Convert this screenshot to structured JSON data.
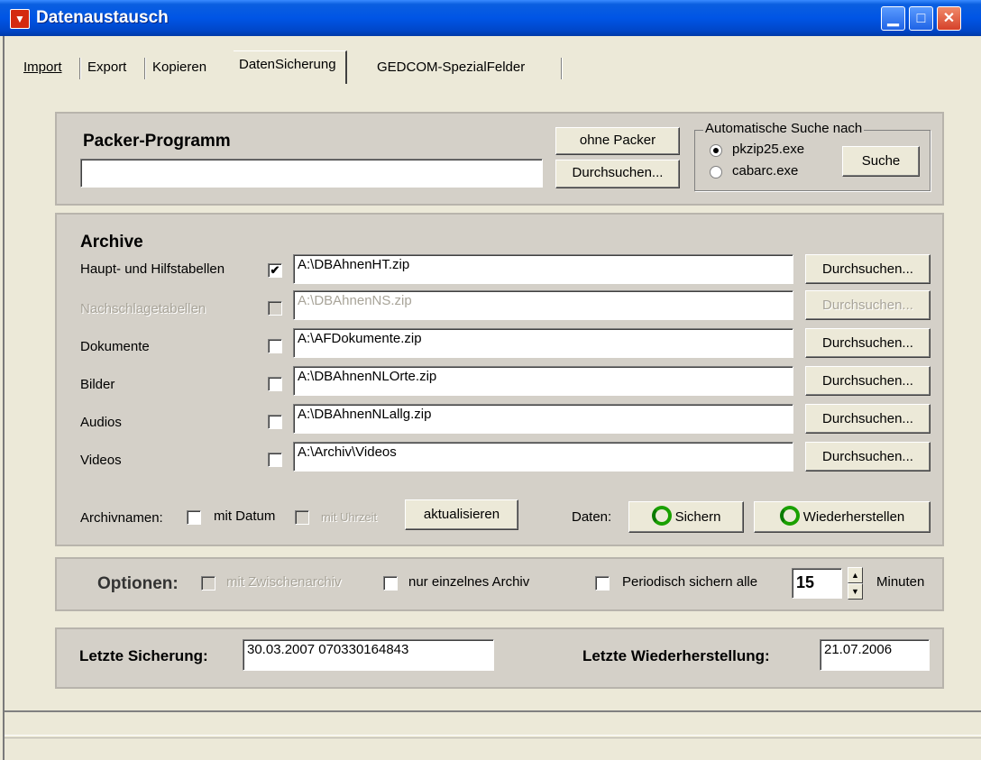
{
  "window": {
    "title": "Datenaustausch",
    "app_icon": "bavaria-flag-icon"
  },
  "tabs": [
    {
      "label": "Import"
    },
    {
      "label": "Export"
    },
    {
      "label": "Kopieren"
    },
    {
      "label": "DatenSicherung",
      "active": true
    },
    {
      "label": "GEDCOM-SpezialFelder"
    }
  ],
  "packer": {
    "heading": "Packer-Programm",
    "path_value": "",
    "ohne_packer_label": "ohne Packer",
    "browse_label": "Durchsuchen...",
    "auto_search": {
      "legend": "Automatische Suche nach",
      "options": [
        {
          "label": "pkzip25.exe",
          "selected": true
        },
        {
          "label": "cabarc.exe",
          "selected": false
        }
      ],
      "search_label": "Suche"
    }
  },
  "archive": {
    "heading": "Archive",
    "rows": [
      {
        "label": "Haupt- und Hilfstabellen",
        "checked": true,
        "enabled": true,
        "path": "A:\\DBAhnenHT.zip",
        "browse": "Durchsuchen..."
      },
      {
        "label": "Nachschlagetabellen",
        "checked": false,
        "enabled": false,
        "path": "A:\\DBAhnenNS.zip",
        "browse": "Durchsuchen..."
      },
      {
        "label": "Dokumente",
        "checked": false,
        "enabled": true,
        "path": "A:\\AFDokumente.zip",
        "browse": "Durchsuchen..."
      },
      {
        "label": "Bilder",
        "checked": false,
        "enabled": true,
        "path": "A:\\DBAhnenNLOrte.zip",
        "browse": "Durchsuchen..."
      },
      {
        "label": "Audios",
        "checked": false,
        "enabled": true,
        "path": "A:\\DBAhnenNLallg.zip",
        "browse": "Durchsuchen..."
      },
      {
        "label": "Videos",
        "checked": false,
        "enabled": true,
        "path": "A:\\Archiv\\Videos",
        "browse": "Durchsuchen..."
      }
    ],
    "names_label": "Archivnamen:",
    "mit_datum": "mit Datum",
    "mit_uhrzeit": "mit Uhrzeit",
    "aktualisieren": "aktualisieren",
    "daten_label": "Daten:",
    "sichern": "Sichern",
    "wiederherstellen": "Wiederherstellen"
  },
  "options": {
    "heading": "Optionen:",
    "zwischenarchiv": "mit Zwischenarchiv",
    "einzelnes": "nur einzelnes Archiv",
    "periodisch": "Periodisch sichern alle",
    "minutes_value": "15",
    "minuten": "Minuten"
  },
  "history": {
    "letzte_sicherung_label": "Letzte Sicherung:",
    "letzte_sicherung_value": "30.03.2007   070330164843",
    "letzte_wiederherstellung_label": "Letzte Wiederherstellung:",
    "letzte_wiederherstellung_value": "21.07.2006"
  }
}
